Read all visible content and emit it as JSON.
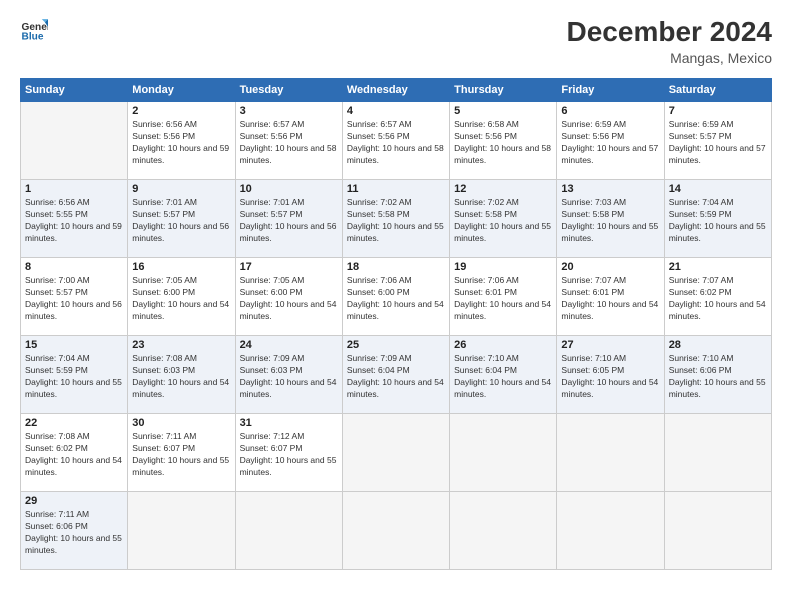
{
  "header": {
    "logo_line1": "General",
    "logo_line2": "Blue",
    "title": "December 2024",
    "subtitle": "Mangas, Mexico"
  },
  "calendar": {
    "headers": [
      "Sunday",
      "Monday",
      "Tuesday",
      "Wednesday",
      "Thursday",
      "Friday",
      "Saturday"
    ],
    "weeks": [
      [
        {
          "day": "",
          "info": ""
        },
        {
          "day": "2",
          "info": "Sunrise: 6:56 AM\nSunset: 5:56 PM\nDaylight: 10 hours and 59 minutes."
        },
        {
          "day": "3",
          "info": "Sunrise: 6:57 AM\nSunset: 5:56 PM\nDaylight: 10 hours and 58 minutes."
        },
        {
          "day": "4",
          "info": "Sunrise: 6:57 AM\nSunset: 5:56 PM\nDaylight: 10 hours and 58 minutes."
        },
        {
          "day": "5",
          "info": "Sunrise: 6:58 AM\nSunset: 5:56 PM\nDaylight: 10 hours and 58 minutes."
        },
        {
          "day": "6",
          "info": "Sunrise: 6:59 AM\nSunset: 5:56 PM\nDaylight: 10 hours and 57 minutes."
        },
        {
          "day": "7",
          "info": "Sunrise: 6:59 AM\nSunset: 5:57 PM\nDaylight: 10 hours and 57 minutes."
        }
      ],
      [
        {
          "day": "1",
          "info": "Sunrise: 6:56 AM\nSunset: 5:55 PM\nDaylight: 10 hours and 59 minutes."
        },
        {
          "day": "9",
          "info": "Sunrise: 7:01 AM\nSunset: 5:57 PM\nDaylight: 10 hours and 56 minutes."
        },
        {
          "day": "10",
          "info": "Sunrise: 7:01 AM\nSunset: 5:57 PM\nDaylight: 10 hours and 56 minutes."
        },
        {
          "day": "11",
          "info": "Sunrise: 7:02 AM\nSunset: 5:58 PM\nDaylight: 10 hours and 55 minutes."
        },
        {
          "day": "12",
          "info": "Sunrise: 7:02 AM\nSunset: 5:58 PM\nDaylight: 10 hours and 55 minutes."
        },
        {
          "day": "13",
          "info": "Sunrise: 7:03 AM\nSunset: 5:58 PM\nDaylight: 10 hours and 55 minutes."
        },
        {
          "day": "14",
          "info": "Sunrise: 7:04 AM\nSunset: 5:59 PM\nDaylight: 10 hours and 55 minutes."
        }
      ],
      [
        {
          "day": "8",
          "info": "Sunrise: 7:00 AM\nSunset: 5:57 PM\nDaylight: 10 hours and 56 minutes."
        },
        {
          "day": "16",
          "info": "Sunrise: 7:05 AM\nSunset: 6:00 PM\nDaylight: 10 hours and 54 minutes."
        },
        {
          "day": "17",
          "info": "Sunrise: 7:05 AM\nSunset: 6:00 PM\nDaylight: 10 hours and 54 minutes."
        },
        {
          "day": "18",
          "info": "Sunrise: 7:06 AM\nSunset: 6:00 PM\nDaylight: 10 hours and 54 minutes."
        },
        {
          "day": "19",
          "info": "Sunrise: 7:06 AM\nSunset: 6:01 PM\nDaylight: 10 hours and 54 minutes."
        },
        {
          "day": "20",
          "info": "Sunrise: 7:07 AM\nSunset: 6:01 PM\nDaylight: 10 hours and 54 minutes."
        },
        {
          "day": "21",
          "info": "Sunrise: 7:07 AM\nSunset: 6:02 PM\nDaylight: 10 hours and 54 minutes."
        }
      ],
      [
        {
          "day": "15",
          "info": "Sunrise: 7:04 AM\nSunset: 5:59 PM\nDaylight: 10 hours and 55 minutes."
        },
        {
          "day": "23",
          "info": "Sunrise: 7:08 AM\nSunset: 6:03 PM\nDaylight: 10 hours and 54 minutes."
        },
        {
          "day": "24",
          "info": "Sunrise: 7:09 AM\nSunset: 6:03 PM\nDaylight: 10 hours and 54 minutes."
        },
        {
          "day": "25",
          "info": "Sunrise: 7:09 AM\nSunset: 6:04 PM\nDaylight: 10 hours and 54 minutes."
        },
        {
          "day": "26",
          "info": "Sunrise: 7:10 AM\nSunset: 6:04 PM\nDaylight: 10 hours and 54 minutes."
        },
        {
          "day": "27",
          "info": "Sunrise: 7:10 AM\nSunset: 6:05 PM\nDaylight: 10 hours and 54 minutes."
        },
        {
          "day": "28",
          "info": "Sunrise: 7:10 AM\nSunset: 6:06 PM\nDaylight: 10 hours and 55 minutes."
        }
      ],
      [
        {
          "day": "22",
          "info": "Sunrise: 7:08 AM\nSunset: 6:02 PM\nDaylight: 10 hours and 54 minutes."
        },
        {
          "day": "30",
          "info": "Sunrise: 7:11 AM\nSunset: 6:07 PM\nDaylight: 10 hours and 55 minutes."
        },
        {
          "day": "31",
          "info": "Sunrise: 7:12 AM\nSunset: 6:07 PM\nDaylight: 10 hours and 55 minutes."
        },
        {
          "day": "",
          "info": ""
        },
        {
          "day": "",
          "info": ""
        },
        {
          "day": "",
          "info": ""
        },
        {
          "day": "",
          "info": ""
        }
      ],
      [
        {
          "day": "29",
          "info": "Sunrise: 7:11 AM\nSunset: 6:06 PM\nDaylight: 10 hours and 55 minutes."
        },
        {
          "day": "",
          "info": ""
        },
        {
          "day": "",
          "info": ""
        },
        {
          "day": "",
          "info": ""
        },
        {
          "day": "",
          "info": ""
        },
        {
          "day": "",
          "info": ""
        },
        {
          "day": "",
          "info": ""
        }
      ]
    ]
  }
}
